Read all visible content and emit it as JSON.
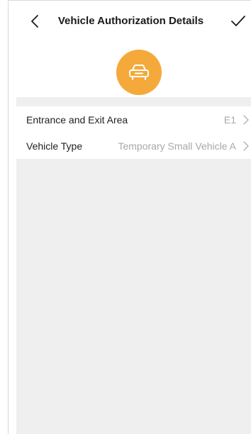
{
  "nav": {
    "title": "Vehicle Authorization Details",
    "back_icon": "chevron-left-icon",
    "confirm_icon": "checkmark-icon"
  },
  "header_icon": {
    "name": "car-icon",
    "color": "#f5a93a"
  },
  "fields": [
    {
      "label": "Entrance and Exit Area",
      "value": "E1"
    },
    {
      "label": "Vehicle Type",
      "value": "Temporary Small Vehicle A"
    }
  ]
}
